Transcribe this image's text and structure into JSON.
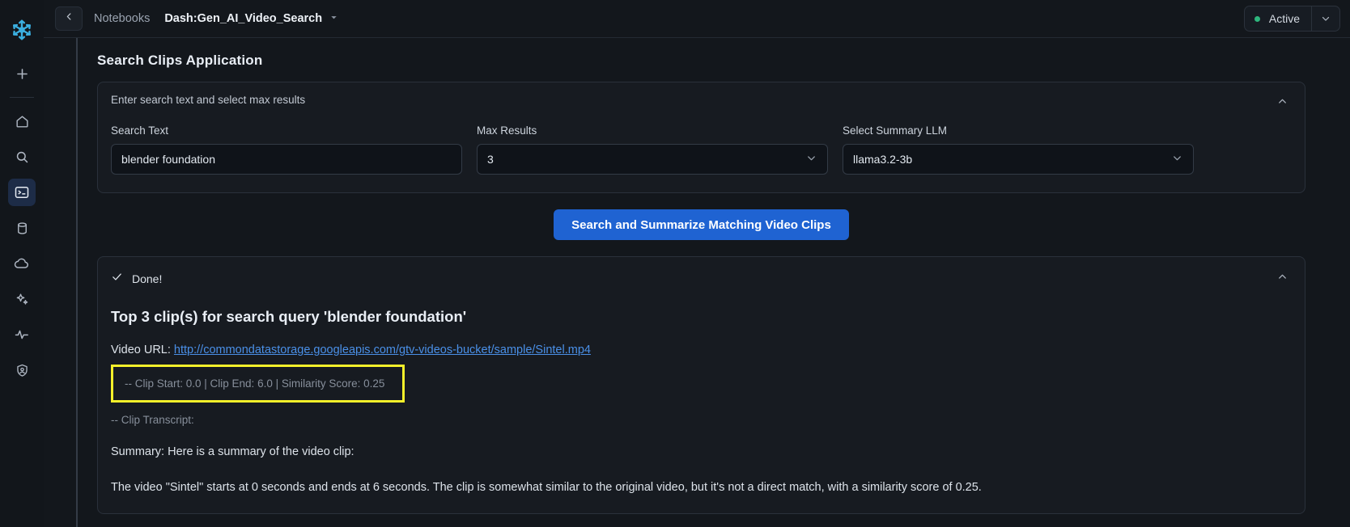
{
  "sidebar": {
    "logo_icon": "snowflake-logo",
    "items": [
      {
        "icon": "plus-icon",
        "name": "create-new"
      },
      {
        "icon": "home-icon",
        "name": "home"
      },
      {
        "icon": "search-icon",
        "name": "search"
      },
      {
        "icon": "notebook-terminal-icon",
        "name": "projects",
        "active": true
      },
      {
        "icon": "database-icon",
        "name": "data"
      },
      {
        "icon": "cloud-icon",
        "name": "marketplace"
      },
      {
        "icon": "sparkle-icon",
        "name": "ai-ml"
      },
      {
        "icon": "activity-pulse-icon",
        "name": "monitoring"
      },
      {
        "icon": "shield-user-icon",
        "name": "admin"
      }
    ]
  },
  "topbar": {
    "back_icon": "chevron-left-icon",
    "breadcrumb_parent": "Notebooks",
    "breadcrumb_current": "Dash:Gen_AI_Video_Search",
    "breadcrumb_caret_icon": "caret-down-icon",
    "status_label": "Active",
    "status_color": "#2eb67d",
    "status_caret_icon": "chevron-down-icon"
  },
  "page_title": "Search Clips Application",
  "form_panel": {
    "caption": "Enter search text and select max results",
    "collapse_icon": "chevron-up-icon",
    "search": {
      "label": "Search Text",
      "value": "blender foundation",
      "placeholder": ""
    },
    "max_results": {
      "label": "Max Results",
      "value": "3",
      "caret_icon": "chevron-down-icon"
    },
    "llm": {
      "label": "Select Summary LLM",
      "value": "llama3.2-3b",
      "caret_icon": "chevron-down-icon"
    }
  },
  "action_button": {
    "label": "Search and Summarize Matching Video Clips",
    "color": "#1f63d2"
  },
  "results_panel": {
    "status_icon": "check-icon",
    "status_label": "Done!",
    "collapse_icon": "chevron-up-icon",
    "heading": "Top 3 clip(s) for search query 'blender foundation'",
    "url_prefix": "Video URL: ",
    "url": "http://commondatastorage.googleapis.com/gtv-videos-bucket/sample/Sintel.mp4",
    "clip_meta": "-- Clip Start: 0.0 | Clip End: 6.0 | Similarity Score: 0.25",
    "highlight_color": "#f5f02a",
    "transcript_label": "-- Clip Transcript:",
    "summary_label": "Summary: Here is a summary of the video clip:",
    "summary_text": "The video \"Sintel\" starts at 0 seconds and ends at 6 seconds. The clip is somewhat similar to the original video, but it's not a direct match, with a similarity score of 0.25."
  }
}
